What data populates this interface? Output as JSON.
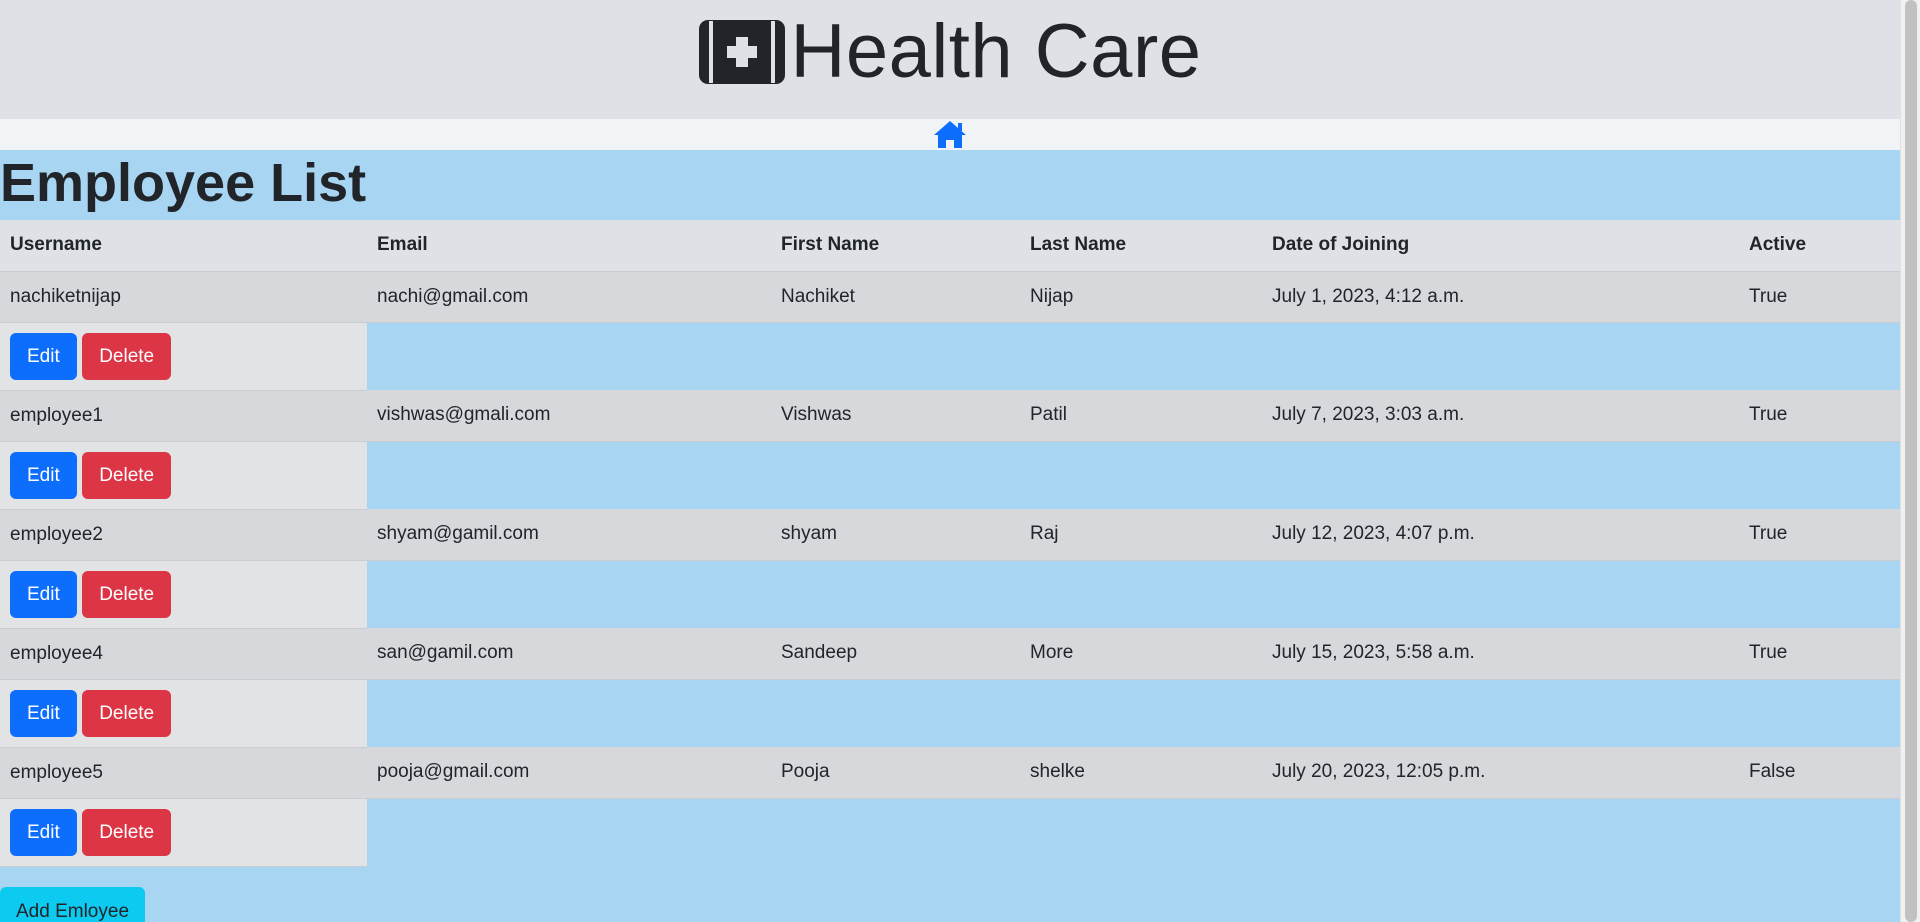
{
  "brand": {
    "title": "Health Care",
    "logo_icon": "medical-kit-icon"
  },
  "nav": {
    "home_icon": "home-icon",
    "accent": "#0d6efd"
  },
  "page": {
    "title": "Employee List"
  },
  "table": {
    "headers": {
      "username": "Username",
      "email": "Email",
      "first_name": "First Name",
      "last_name": "Last Name",
      "date_of_joining": "Date of Joining",
      "active": "Active"
    },
    "rows": [
      {
        "username": "nachiketnijap",
        "email": "nachi@gmail.com",
        "first_name": "Nachiket",
        "last_name": "Nijap",
        "date_of_joining": "July 1, 2023, 4:12 a.m.",
        "active": "True"
      },
      {
        "username": "employee1",
        "email": "vishwas@gmali.com",
        "first_name": "Vishwas",
        "last_name": "Patil",
        "date_of_joining": "July 7, 2023, 3:03 a.m.",
        "active": "True"
      },
      {
        "username": "employee2",
        "email": "shyam@gamil.com",
        "first_name": "shyam",
        "last_name": "Raj",
        "date_of_joining": "July 12, 2023, 4:07 p.m.",
        "active": "True"
      },
      {
        "username": "employee4",
        "email": "san@gamil.com",
        "first_name": "Sandeep",
        "last_name": "More",
        "date_of_joining": "July 15, 2023, 5:58 a.m.",
        "active": "True"
      },
      {
        "username": "employee5",
        "email": "pooja@gmail.com",
        "first_name": "Pooja",
        "last_name": "shelke",
        "date_of_joining": "July 20, 2023, 12:05 p.m.",
        "active": "False"
      }
    ],
    "edit_label": "Edit",
    "delete_label": "Delete"
  },
  "actions": {
    "add_label": "Add Emloyee"
  },
  "colors": {
    "edit": "#0d6efd",
    "delete": "#dc3545",
    "add": "#0dcaf0",
    "background": "#a8d5f2"
  }
}
